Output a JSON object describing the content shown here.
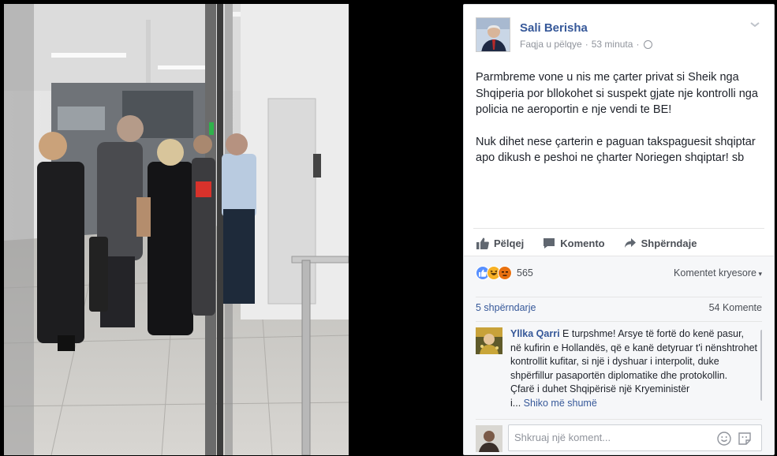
{
  "post": {
    "author": "Sali Berisha",
    "page_label": "Faqja u pëlqye",
    "separator": "·",
    "time": "53 minuta",
    "paragraphs": [
      "Parmbreme vone u nis me çarter privat si Sheik nga Shqiperia por bllokohet si suspekt gjate nje kontrolli nga policia ne aeroportin e nje vendi te BE!",
      "Nuk dihet nese çarterin e paguan takspaguesit shqiptar apo dikush e peshoi ne çharter Noriegen shqiptar! sb"
    ]
  },
  "actions": {
    "like": "Pëlqej",
    "comment": "Komento",
    "share": "Shpërndaje"
  },
  "stats": {
    "reactions_count": "565",
    "top_comments_label": "Komentet kryesore",
    "shares": "5 shpërndarje",
    "comments": "54 Komente"
  },
  "comment": {
    "author": "Yllka Qarri",
    "text_1": "E turpshme! Arsye të fortë do kenë pasur, në kufirin e Hollandës, që e kanë detyruar t'i nënshtrohet kontrollit kufitar, si një i dyshuar i interpolit, duke shpërfillur pasaportën diplomatike dhe protokollin.",
    "text_2": "Çfarë i duhet Shqipërisë një Kryeministër",
    "see_more": "Shiko më shumë"
  },
  "composer": {
    "placeholder": "Shkruaj një koment..."
  },
  "icons": {
    "like": "thumbs-up-icon",
    "comment": "speech-bubble-icon",
    "share": "share-arrow-icon",
    "globe": "globe-icon",
    "menu": "chevron-down-icon",
    "emoji": "smiley-icon",
    "sticker": "sticker-icon"
  },
  "colors": {
    "link_blue": "#365899",
    "like_blue": "#5890ff",
    "haha_yellow": "#f7b125",
    "angry_red": "#e9710f",
    "background": "#000000"
  }
}
